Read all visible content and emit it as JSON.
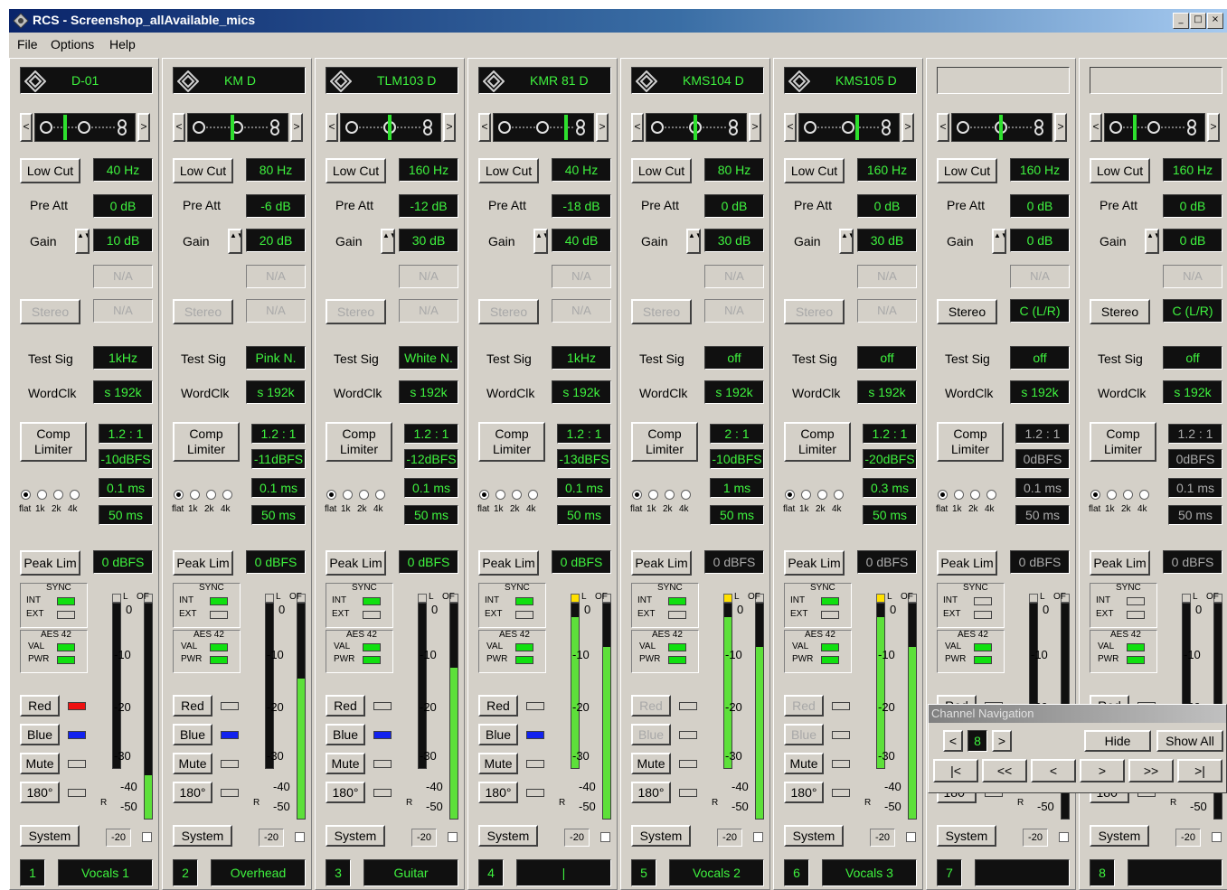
{
  "window": {
    "title": "RCS - Screenshop_allAvailable_mics"
  },
  "menu": [
    "File",
    "Options",
    "Help"
  ],
  "labels": {
    "low_cut": "Low Cut",
    "pre_att": "Pre Att",
    "gain": "Gain",
    "stereo": "Stereo",
    "test_sig": "Test Sig",
    "wordclk": "WordClk",
    "comp": "Comp",
    "limiter": "Limiter",
    "peak_lim": "Peak Lim",
    "sync": "SYNC",
    "int": "INT",
    "ext": "EXT",
    "aes42": "AES 42",
    "val": "VAL",
    "pwr": "PWR",
    "red": "Red",
    "blue": "Blue",
    "mute": "Mute",
    "phase": "180°",
    "system": "System",
    "sys_val": "-20",
    "meter_l": "L",
    "meter_of": "OF",
    "meter_r": "R",
    "freq_labels": [
      "flat",
      "1k",
      "2k",
      "4k"
    ],
    "scale": [
      "0",
      "-10",
      "-20",
      "-30",
      "-40",
      "-50"
    ]
  },
  "channels": [
    {
      "mic": "D-01",
      "lowcut": "40 Hz",
      "preatt": "0 dB",
      "gain": "10 dB",
      "stereo_val": "N/A",
      "stereo_enabled": false,
      "testsig": "1kHz",
      "wordclk": "s 192k",
      "ratio": "1.2 : 1",
      "threshold": "-10dBFS",
      "attack": "0.1 ms",
      "release": "50 ms",
      "comp_active": true,
      "peaklim": "0 dBFS",
      "peak_active": true,
      "sync_int": true,
      "sync_ext": false,
      "led_red": true,
      "led_blue": true,
      "red_enabled": true,
      "meter_l": 0,
      "meter_r": 0.2,
      "clip_l": false,
      "clip_r": false,
      "num": "1",
      "name": "Vocals 1",
      "slider": 0.3
    },
    {
      "mic": "KM D",
      "lowcut": "80 Hz",
      "preatt": "-6 dB",
      "gain": "20 dB",
      "stereo_val": "N/A",
      "stereo_enabled": false,
      "testsig": "Pink N.",
      "wordclk": "s 192k",
      "ratio": "1.2 : 1",
      "threshold": "-11dBFS",
      "attack": "0.1 ms",
      "release": "50 ms",
      "comp_active": true,
      "peaklim": "0 dBFS",
      "peak_active": true,
      "sync_int": true,
      "sync_ext": false,
      "led_red": false,
      "led_blue": true,
      "red_enabled": true,
      "meter_l": 0,
      "meter_r": 0.65,
      "clip_l": false,
      "clip_r": false,
      "num": "2",
      "name": "Overhead",
      "slider": 0.45
    },
    {
      "mic": "TLM103 D",
      "lowcut": "160 Hz",
      "preatt": "-12 dB",
      "gain": "30 dB",
      "stereo_val": "N/A",
      "stereo_enabled": false,
      "testsig": "White N.",
      "wordclk": "s 192k",
      "ratio": "1.2 : 1",
      "threshold": "-12dBFS",
      "attack": "0.1 ms",
      "release": "50 ms",
      "comp_active": true,
      "peaklim": "0 dBFS",
      "peak_active": true,
      "sync_int": true,
      "sync_ext": false,
      "led_red": false,
      "led_blue": true,
      "red_enabled": true,
      "meter_l": 0,
      "meter_r": 0.7,
      "clip_l": false,
      "clip_r": false,
      "num": "3",
      "name": "Guitar",
      "slider": 0.5
    },
    {
      "mic": "KMR 81 D",
      "lowcut": "40 Hz",
      "preatt": "-18 dB",
      "gain": "40 dB",
      "stereo_val": "N/A",
      "stereo_enabled": false,
      "testsig": "1kHz",
      "wordclk": "s 192k",
      "ratio": "1.2 : 1",
      "threshold": "-13dBFS",
      "attack": "0.1 ms",
      "release": "50 ms",
      "comp_active": true,
      "peaklim": "0 dBFS",
      "peak_active": true,
      "sync_int": true,
      "sync_ext": false,
      "led_red": false,
      "led_blue": true,
      "red_enabled": true,
      "meter_l": 0.92,
      "meter_r": 0.8,
      "clip_l": true,
      "clip_r": false,
      "num": "4",
      "name": "|",
      "slider": 0.75
    },
    {
      "mic": "KMS104 D",
      "lowcut": "80 Hz",
      "preatt": "0 dB",
      "gain": "30 dB",
      "stereo_val": "N/A",
      "stereo_enabled": false,
      "testsig": "off",
      "wordclk": "s 192k",
      "ratio": "2 : 1",
      "threshold": "-10dBFS",
      "attack": "1 ms",
      "release": "50 ms",
      "comp_active": true,
      "peaklim": "0 dBFS",
      "peak_active": false,
      "sync_int": true,
      "sync_ext": false,
      "led_red": false,
      "led_blue": false,
      "red_enabled": false,
      "meter_l": 0.92,
      "meter_r": 0.8,
      "clip_l": true,
      "clip_r": false,
      "num": "5",
      "name": "Vocals 2",
      "slider": 0.5
    },
    {
      "mic": "KMS105 D",
      "lowcut": "160 Hz",
      "preatt": "0 dB",
      "gain": "30 dB",
      "stereo_val": "N/A",
      "stereo_enabled": false,
      "testsig": "off",
      "wordclk": "s 192k",
      "ratio": "1.2 : 1",
      "threshold": "-20dBFS",
      "attack": "0.3 ms",
      "release": "50 ms",
      "comp_active": true,
      "peaklim": "0 dBFS",
      "peak_active": false,
      "sync_int": true,
      "sync_ext": false,
      "led_red": false,
      "led_blue": false,
      "red_enabled": false,
      "meter_l": 0.92,
      "meter_r": 0.8,
      "clip_l": true,
      "clip_r": false,
      "num": "6",
      "name": "Vocals 3",
      "slider": 0.6
    },
    {
      "mic": "",
      "lowcut": "160 Hz",
      "preatt": "0 dB",
      "gain": "0 dB",
      "stereo_val": "C (L/R)",
      "stereo_enabled": true,
      "testsig": "off",
      "wordclk": "s 192k",
      "ratio": "1.2 : 1",
      "threshold": "0dBFS",
      "attack": "0.1 ms",
      "release": "50 ms",
      "comp_active": false,
      "peaklim": "0 dBFS",
      "peak_active": false,
      "sync_int": false,
      "sync_ext": false,
      "led_red": false,
      "led_blue": false,
      "red_enabled": true,
      "meter_l": 0,
      "meter_r": 0,
      "clip_l": false,
      "clip_r": false,
      "num": "7",
      "name": "",
      "slider": 0.5
    },
    {
      "mic": "",
      "lowcut": "160 Hz",
      "preatt": "0 dB",
      "gain": "0 dB",
      "stereo_val": "C (L/R)",
      "stereo_enabled": true,
      "testsig": "off",
      "wordclk": "s 192k",
      "ratio": "1.2 : 1",
      "threshold": "0dBFS",
      "attack": "0.1 ms",
      "release": "50 ms",
      "comp_active": false,
      "peaklim": "0 dBFS",
      "peak_active": false,
      "sync_int": false,
      "sync_ext": false,
      "led_red": false,
      "led_blue": false,
      "red_enabled": true,
      "meter_l": 0,
      "meter_r": 0,
      "clip_l": false,
      "clip_r": false,
      "num": "8",
      "name": "",
      "slider": 0.3
    }
  ],
  "nav": {
    "title": "Channel Navigation",
    "prev": "<",
    "page": "8",
    "next": ">",
    "hide": "Hide",
    "show_all": "Show All",
    "first": "|<",
    "back_fast": "<<",
    "back": "<",
    "fwd": ">",
    "fwd_fast": ">>",
    "last": ">|"
  },
  "colors": {
    "display_bg": "#101010",
    "display_text": "#3ef23e",
    "led_on": "#10e010",
    "meter": "#5de03a",
    "clip": "#ffe000",
    "red_led": "#ee1111",
    "blue_led": "#1122ee"
  }
}
